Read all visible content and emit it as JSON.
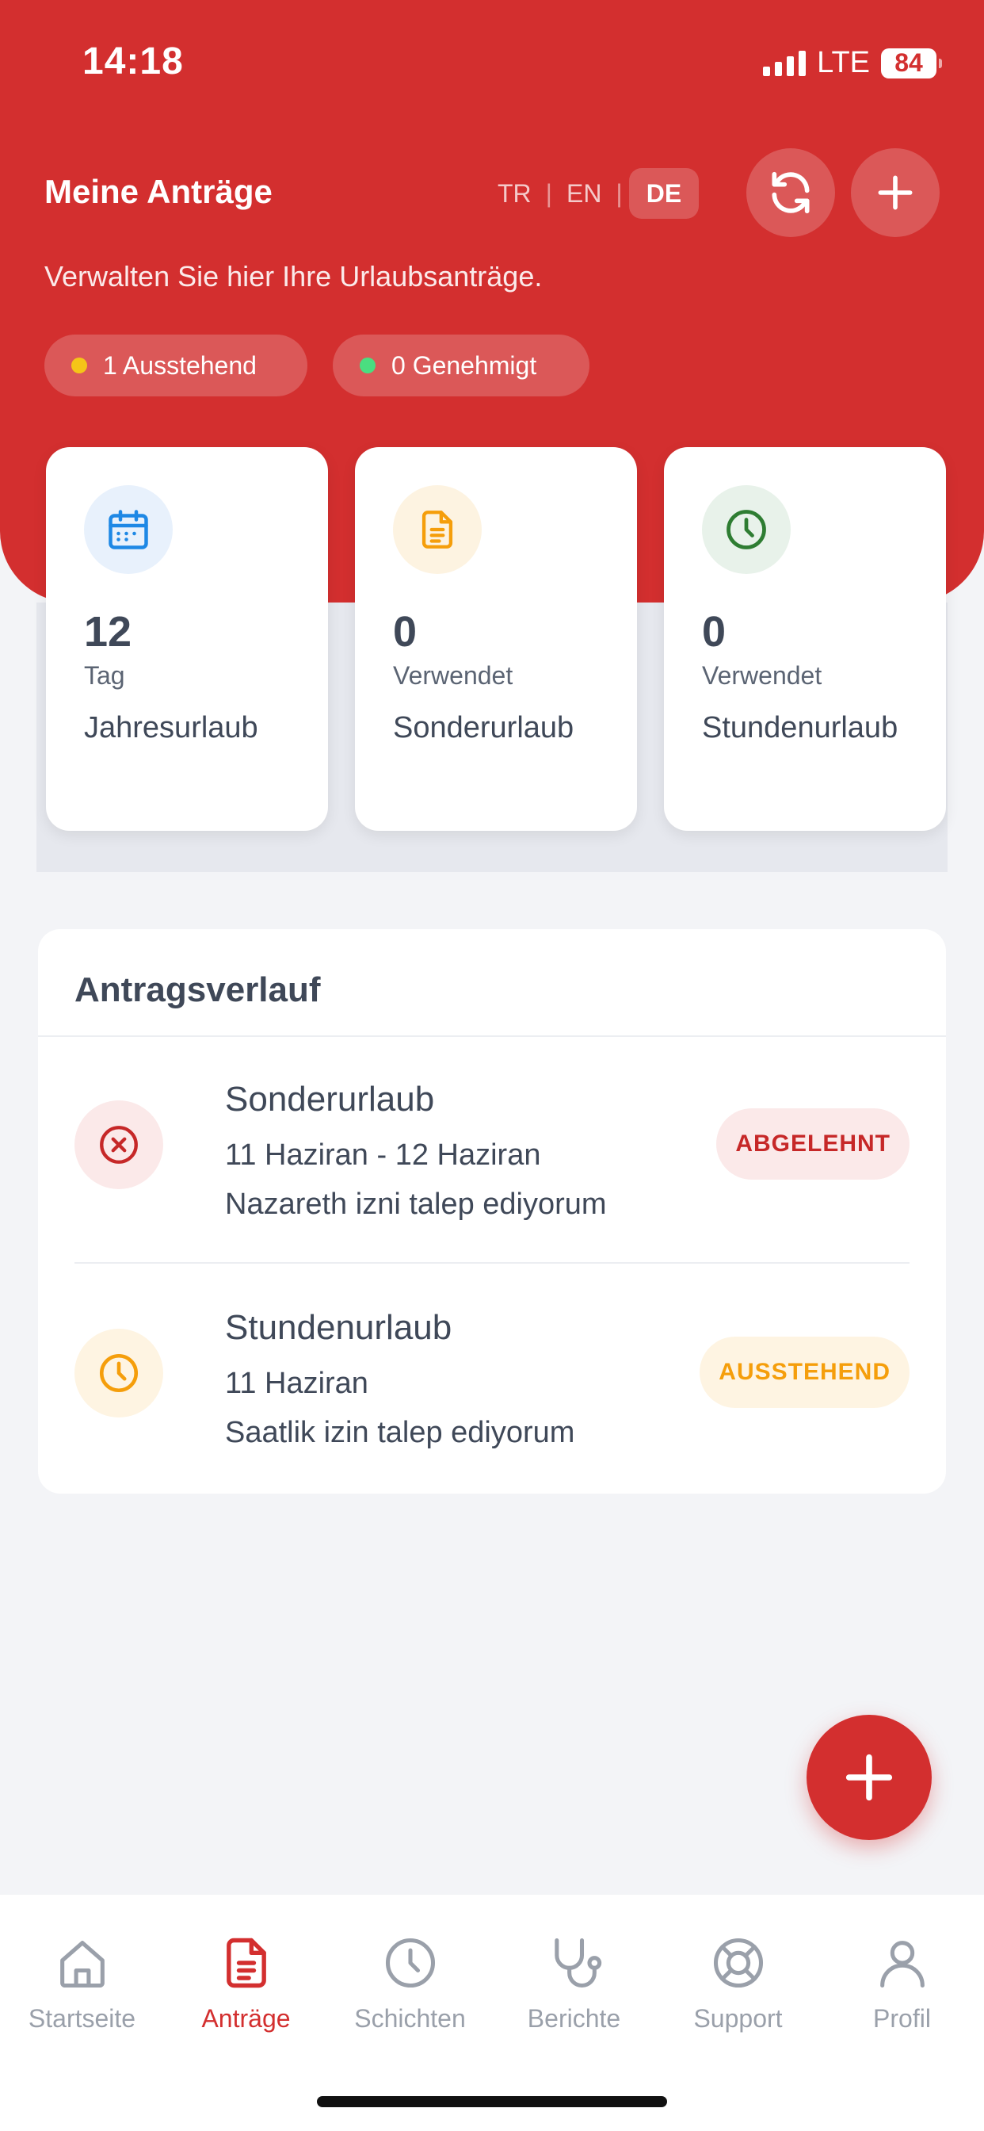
{
  "status_bar": {
    "time": "14:18",
    "network": "LTE",
    "battery": "84"
  },
  "header": {
    "title": "Meine Anträge",
    "subtitle": "Verwalten Sie hier Ihre Urlaubsanträge.",
    "languages": [
      "TR",
      "EN",
      "DE"
    ],
    "active_language": "DE",
    "pills": [
      {
        "label": "1 Ausstehend",
        "dot_color": "#f5c518"
      },
      {
        "label": "0 Genehmigt",
        "dot_color": "#4ade80"
      }
    ]
  },
  "stats": [
    {
      "value": "12",
      "unit": "Tag",
      "label": "Jahresurlaub",
      "icon": "calendar-icon",
      "color": "#1e88e5"
    },
    {
      "value": "0",
      "unit": "Verwendet",
      "label": "Sonderurlaub",
      "icon": "document-icon",
      "color": "#f59e0b"
    },
    {
      "value": "0",
      "unit": "Verwendet",
      "label": "Stundenurlaub",
      "icon": "clock-icon",
      "color": "#2e7d32"
    }
  ],
  "history": {
    "title": "Antragsverlauf",
    "items": [
      {
        "type": "Sonderurlaub",
        "date": "11 Haziran - 12 Haziran",
        "note": "Nazareth izni talep ediyorum",
        "status": "ABGELEHNT",
        "icon": "x-circle-icon"
      },
      {
        "type": "Stundenurlaub",
        "date": "11 Haziran",
        "note": "Saatlik izin talep ediyorum",
        "status": "AUSSTEHEND",
        "icon": "clock-icon"
      }
    ]
  },
  "tabs": [
    {
      "label": "Startseite",
      "icon": "home-icon"
    },
    {
      "label": "Anträge",
      "icon": "document-icon",
      "active": true
    },
    {
      "label": "Schichten",
      "icon": "clock-icon"
    },
    {
      "label": "Berichte",
      "icon": "stethoscope-icon"
    },
    {
      "label": "Support",
      "icon": "lifebuoy-icon"
    },
    {
      "label": "Profil",
      "icon": "user-icon"
    }
  ],
  "colors": {
    "primary": "#d32f2f",
    "rejected": "#c62828",
    "pending": "#f59e0b"
  }
}
